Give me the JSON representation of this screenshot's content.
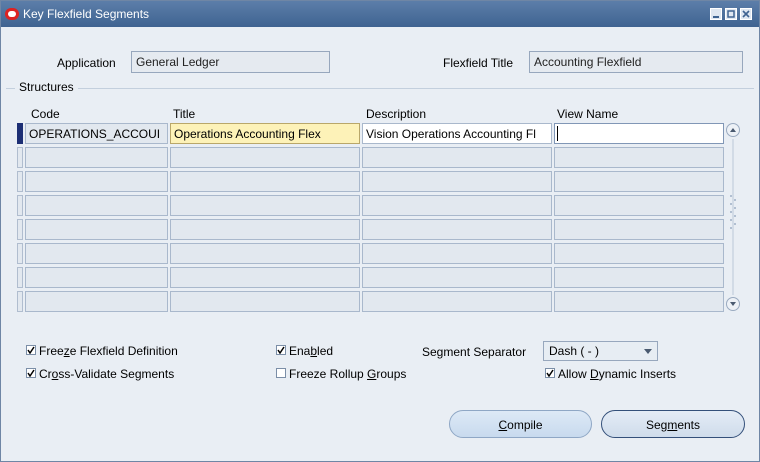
{
  "window": {
    "title": "Key Flexfield Segments"
  },
  "header": {
    "application_label": "Application",
    "application_value": "General Ledger",
    "flexfield_title_label": "Flexfield Title",
    "flexfield_title_value": "Accounting Flexfield"
  },
  "structures": {
    "group_label": "Structures",
    "columns": {
      "code": "Code",
      "title": "Title",
      "description": "Description",
      "view_name": "View Name"
    },
    "rows": [
      {
        "code": "OPERATIONS_ACCOUI",
        "title": "Operations Accounting Flex",
        "description": "Vision Operations Accounting Fl",
        "view_name": ""
      }
    ],
    "empty_row_count": 7
  },
  "options": {
    "freeze_pre": "Free",
    "freeze_mn": "z",
    "freeze_post": "e Flexfield Definition",
    "freeze_checked": true,
    "cross_pre": "Cr",
    "cross_mn": "o",
    "cross_post": "ss-Validate Segments",
    "cross_checked": true,
    "enabled_pre": "Ena",
    "enabled_mn": "b",
    "enabled_post": "led",
    "enabled_checked": true,
    "rollup_pre": "Freeze Rollup ",
    "rollup_mn": "G",
    "rollup_post": "roups",
    "rollup_checked": false,
    "separator_label": "Segment Separator",
    "separator_value": "Dash ( - )",
    "dynamic_pre": "Allow ",
    "dynamic_mn": "D",
    "dynamic_post": "ynamic Inserts",
    "dynamic_checked": true
  },
  "buttons": {
    "compile_mn": "C",
    "compile_post": "ompile",
    "segments_pre": "Seg",
    "segments_mn": "m",
    "segments_post": "ents"
  },
  "colors": {
    "titlebar": "#4a6d9c",
    "current_row": "#1c2e74",
    "highlight": "#fdf2b8"
  }
}
